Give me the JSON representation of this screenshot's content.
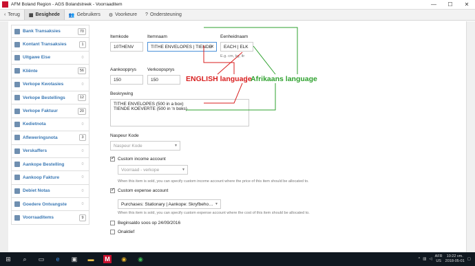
{
  "window": {
    "title": "AFM Boland Region - AGS Bolandstreek - Voorraaditem",
    "min": "—",
    "max": "☐",
    "close": "✕"
  },
  "nav": {
    "back": "Terug",
    "tabs": [
      {
        "label": "Besighede",
        "icon": "▦"
      },
      {
        "label": "Gebruikers",
        "icon": "👥"
      },
      {
        "label": "Voorkeure",
        "icon": "⚙"
      },
      {
        "label": "Ondersteuning",
        "icon": "?"
      }
    ]
  },
  "sidebar": {
    "items": [
      {
        "label": "Bank Transaksies",
        "badge": "70"
      },
      {
        "label": "Kontant Transaksies",
        "badge": "1"
      },
      {
        "label": "Uitgawe Eise",
        "badge": "0"
      },
      {
        "label": "Kliënte",
        "badge": "56"
      },
      {
        "label": "Verkope Kwotasies",
        "badge": "0"
      },
      {
        "label": "Verkope Bestellings",
        "badge": "12"
      },
      {
        "label": "Verkope Faktuur",
        "badge": "20"
      },
      {
        "label": "Kedietnota",
        "badge": "0"
      },
      {
        "label": "Afleweringsnota",
        "badge": "3"
      },
      {
        "label": "Verskaffers",
        "badge": "0"
      },
      {
        "label": "Aankope Bestelling",
        "badge": "0"
      },
      {
        "label": "Aankoop Fakture",
        "badge": "0"
      },
      {
        "label": "Debiet Notas",
        "badge": "0"
      },
      {
        "label": "Goedere Ontvangste",
        "badge": "0"
      },
      {
        "label": "Voorraaditems",
        "badge": "9"
      }
    ]
  },
  "form": {
    "itemkode_label": "Itemkode",
    "itemkode_value": "10THENV",
    "itemnaam_label": "Itemnaam",
    "itemnaam_value": "TITHE ENVELOPES | TIENDE",
    "eenheid_label": "Eenheidnaam",
    "eenheid_value": "EACH | ELK",
    "eenheid_hint": "E.g. cm, kg, ltr",
    "aankoop_label": "Aankoopprys",
    "aankoop_value": "150",
    "verkoop_label": "Verkoopsprys",
    "verkoop_value": "150",
    "beskrywing_label": "Beskrywing",
    "beskrywing_line1": "TITHE ENVELOPES (500 in a box)",
    "beskrywing_line2": "TIENDE KOEVERTE (500 in 'n boks)",
    "naspeur_label": "Naspeur Kode",
    "naspeur_placeholder": "Naspeur Kode",
    "income_label": "Custom income account",
    "income_value": "Voorraad - verkope",
    "income_hint": "When this item is sold, you can specify custom income account where the price of this item should be allocated to.",
    "expense_label": "Custom expense account",
    "expense_value": "Purchases: Stationary | Aankope: Skryfbeho…",
    "expense_hint": "When this item is sold, you can specify custom expense account where the cost of this item should be allocated to.",
    "beginsaldo_label": "Beginsaldo soos op 24/09/2016",
    "onaktief_label": "Onaktief"
  },
  "annotation": {
    "english": "ENGLISH language",
    "separator": "|",
    "afrikaans": "Afrikaans language",
    "red": "#d81e1e",
    "green": "#2ea12e"
  },
  "taskbar": {
    "lang1": "AFR",
    "lang2": "US",
    "time": "10:22 vm.",
    "date": "2018-05-01"
  }
}
